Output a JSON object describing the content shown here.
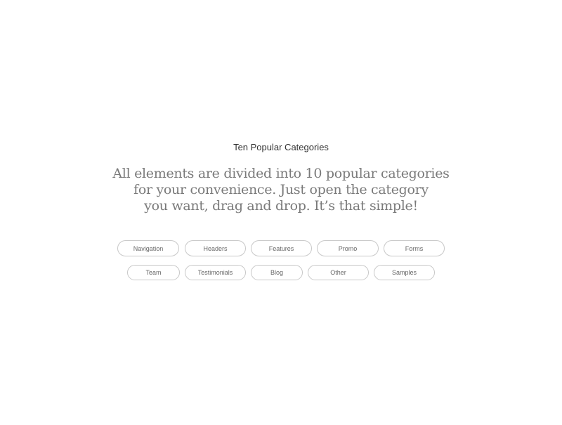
{
  "section": {
    "title": "Ten Popular Categories",
    "description": [
      "All elements are divided into 10 popular categories",
      "for your convenience. Just open the category",
      "you want, drag and drop. It’s that simple!"
    ]
  },
  "categories": [
    {
      "label": "Navigation"
    },
    {
      "label": "Headers"
    },
    {
      "label": "Features"
    },
    {
      "label": "Promo"
    },
    {
      "label": "Forms"
    },
    {
      "label": "Team"
    },
    {
      "label": "Testimonials"
    },
    {
      "label": "Blog"
    },
    {
      "label": "Other"
    },
    {
      "label": "Samples"
    }
  ]
}
